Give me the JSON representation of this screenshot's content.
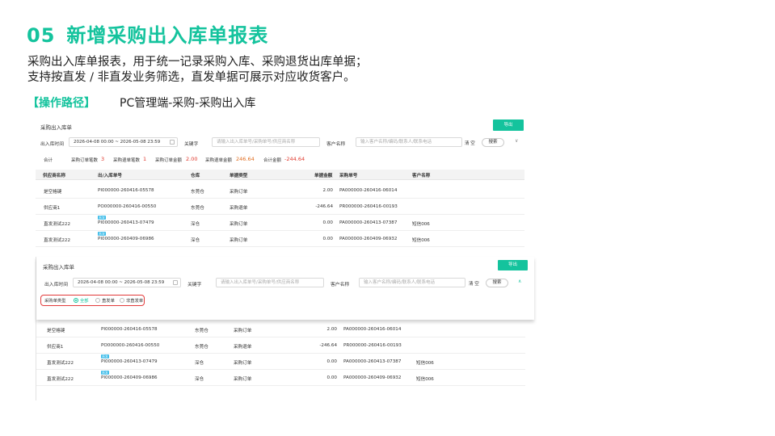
{
  "slide": {
    "number": "05",
    "title": "新增采购出入库单报表",
    "desc_line1": "采购出入库单报表，用于统一记录采购入库、采购退货出库单据；",
    "desc_line2": "支持按直发 / 非直发业务筛选，直发单据可展示对应收货客户。",
    "path_tag": "【操作路径】",
    "path_route": "PC管理端-采购-采购出入库"
  },
  "colors": {
    "accent": "#14c39d",
    "red": "#e0392d",
    "badge": "#35b9e8"
  },
  "panel1": {
    "title": "采购出入库单",
    "export_label": "导出",
    "filter": {
      "date_label": "出入库时间",
      "date_value": "2026-04-08 00:00  ~  2026-05-08 23:59",
      "keyword_label": "关键字",
      "keyword_placeholder": "请输入出入库单号/采购单号/供应商名称",
      "customer_label": "客户名称",
      "customer_placeholder": "输入客户名称/编码/联系人/联系电话",
      "clear_label": "清 空",
      "search_label": "搜索",
      "expand_icon": "chevron-down-icon"
    },
    "summary": {
      "total_label": "合计",
      "po_count_label": "采购订单笔数",
      "po_count": "3",
      "ret_count_label": "采购退单笔数",
      "ret_count": "1",
      "po_amount_label": "采购订单金额",
      "po_amount": "2.00",
      "ret_amount_label": "采购退单金额",
      "ret_amount": "246.64",
      "total_amount_label": "合计金额",
      "total_amount": "-244.64"
    },
    "columns": [
      "供应商名称",
      "出/入库单号",
      "仓库",
      "单据类型",
      "单据金额",
      "采购单号",
      "客户名称"
    ],
    "rows": [
      {
        "supplier": "是空格键",
        "no": "PI000000-260416-05578",
        "badge": "",
        "wh": "东莞仓",
        "type": "采购订单",
        "amount": "2.00",
        "po": "PA000000-260416-06014",
        "customer": ""
      },
      {
        "supplier": "供应商1",
        "no": "PO000000-260416-00550",
        "badge": "",
        "wh": "东莞仓",
        "type": "采购退单",
        "amount": "-246.64",
        "po": "PR000000-260416-00193",
        "customer": ""
      },
      {
        "supplier": "直发测试222",
        "no": "PI000000-260413-07479",
        "badge": "直发",
        "wh": "深仓",
        "type": "采购订单",
        "amount": "0.00",
        "po": "PA000000-260413-07387",
        "customer": "短信006"
      },
      {
        "supplier": "直发测试222",
        "no": "PI000000-260409-06986",
        "badge": "直发",
        "wh": "深仓",
        "type": "采购订单",
        "amount": "0.00",
        "po": "PA000000-260409-06932",
        "customer": "短信006"
      }
    ]
  },
  "panel2": {
    "title": "采购出入库单",
    "export_label": "导出",
    "filter": {
      "date_label": "出入库时间",
      "date_value": "2026-04-08 00:00  ~  2026-05-08 23:59",
      "keyword_label": "关键字",
      "keyword_placeholder": "请输入出入库单号/采购单号/供应商名称",
      "customer_label": "客户名称",
      "customer_placeholder": "输入客户名称/编码/联系人/联系电话",
      "clear_label": "清 空",
      "search_label": "搜索",
      "collapse_icon": "chevron-up-icon"
    },
    "type_filter": {
      "label": "采购单类型",
      "options": [
        "全部",
        "直发单",
        "非直发单"
      ],
      "selected": "全部"
    },
    "rows": [
      {
        "supplier": "是空格键",
        "no": "PI000000-260416-05578",
        "badge": "",
        "wh": "东莞仓",
        "type": "采购订单",
        "amount": "2.00",
        "po": "PA000000-260416-06014",
        "customer": ""
      },
      {
        "supplier": "供应商1",
        "no": "PO000000-260416-00550",
        "badge": "",
        "wh": "东莞仓",
        "type": "采购退单",
        "amount": "-246.64",
        "po": "PR000000-260416-00193",
        "customer": ""
      },
      {
        "supplier": "直发测试222",
        "no": "PI000000-260413-07479",
        "badge": "直发",
        "wh": "深仓",
        "type": "采购订单",
        "amount": "0.00",
        "po": "PA000000-260413-07387",
        "customer": "短信006"
      },
      {
        "supplier": "直发测试222",
        "no": "PI000000-260409-06986",
        "badge": "直发",
        "wh": "深仓",
        "type": "采购订单",
        "amount": "0.00",
        "po": "PA000000-260409-06932",
        "customer": "短信006"
      }
    ]
  }
}
